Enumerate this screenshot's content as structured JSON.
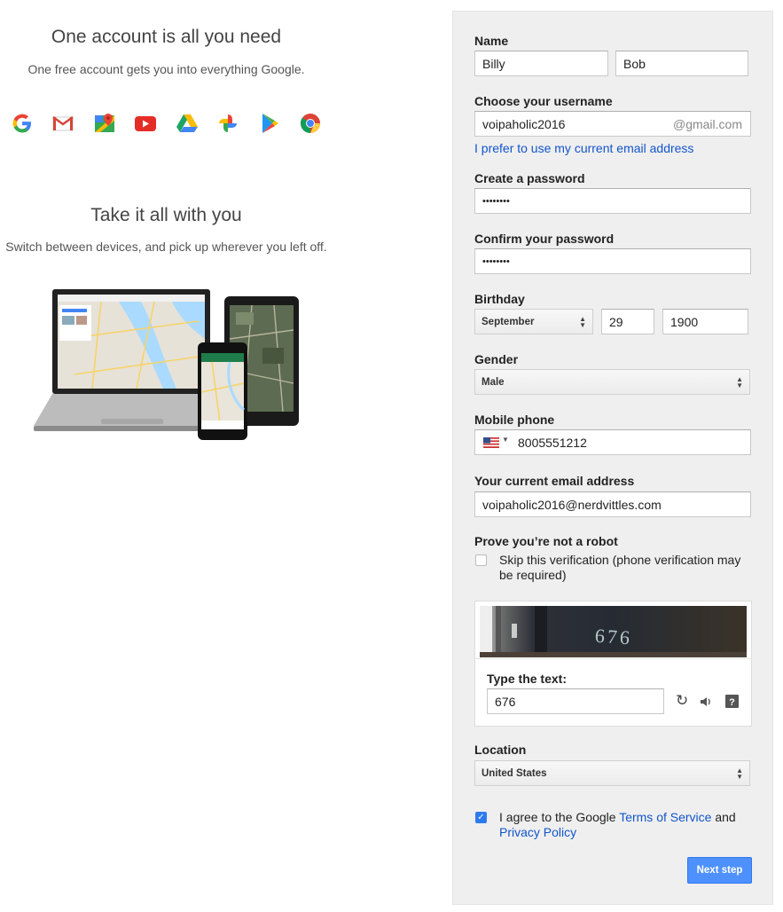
{
  "left": {
    "headline1": "One account is all you need",
    "subline1": "One free account gets you into everything Google.",
    "headline2": "Take it all with you",
    "subline2": "Switch between devices, and pick up wherever you left off.",
    "app_icons": [
      "google-icon",
      "gmail-icon",
      "maps-icon",
      "youtube-icon",
      "drive-icon",
      "photos-icon",
      "play-icon",
      "chrome-icon"
    ]
  },
  "form": {
    "name_label": "Name",
    "first_name": "Billy",
    "last_name": "Bob",
    "username_label": "Choose your username",
    "username": "voipaholic2016",
    "username_suffix": "@gmail.com",
    "prefer_link": "I prefer to use my current email address",
    "password_label": "Create a password",
    "password": "••••••••",
    "confirm_label": "Confirm your password",
    "confirm": "••••••••",
    "birthday_label": "Birthday",
    "birth_month": "September",
    "birth_day": "29",
    "birth_year": "1900",
    "gender_label": "Gender",
    "gender": "Male",
    "phone_label": "Mobile phone",
    "phone": "8005551212",
    "email_label": "Your current email address",
    "email": "voipaholic2016@nerdvittles.com",
    "robot_label": "Prove you’re not a robot",
    "skip_text": "Skip this verification (phone verification may be required)",
    "captcha_text": "676",
    "type_text_label": "Type the text:",
    "captcha_input": "676",
    "location_label": "Location",
    "location": "United States",
    "agree_prefix": "I agree to the Google ",
    "tos_link": "Terms of Service",
    "agree_and": " and",
    "privacy_link": "Privacy Policy",
    "next_button": "Next step"
  },
  "colors": {
    "accent": "#4d90fe",
    "link": "#1155cc",
    "panel": "#efefef"
  }
}
